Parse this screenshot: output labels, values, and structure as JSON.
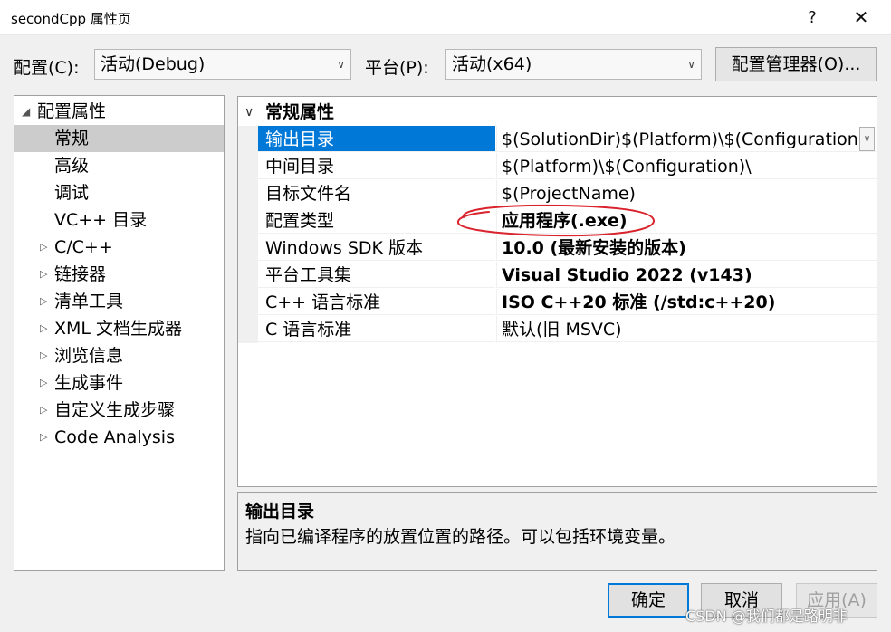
{
  "window": {
    "title": "secondCpp 属性页",
    "help_glyph": "?",
    "close_glyph": "✕"
  },
  "toolbar": {
    "config_label": "配置(C):",
    "config_value": "活动(Debug)",
    "platform_label": "平台(P):",
    "platform_value": "活动(x64)",
    "config_manager_label": "配置管理器(O)..."
  },
  "tree": {
    "items": [
      {
        "label": "配置属性",
        "expander": "open"
      },
      {
        "label": "常规",
        "expander": "none",
        "selected": true
      },
      {
        "label": "高级",
        "expander": "none"
      },
      {
        "label": "调试",
        "expander": "none"
      },
      {
        "label": "VC++ 目录",
        "expander": "none"
      },
      {
        "label": "C/C++",
        "expander": "closed"
      },
      {
        "label": "链接器",
        "expander": "closed"
      },
      {
        "label": "清单工具",
        "expander": "closed"
      },
      {
        "label": "XML 文档生成器",
        "expander": "closed"
      },
      {
        "label": "浏览信息",
        "expander": "closed"
      },
      {
        "label": "生成事件",
        "expander": "closed"
      },
      {
        "label": "自定义生成步骤",
        "expander": "closed"
      },
      {
        "label": "Code Analysis",
        "expander": "closed"
      }
    ]
  },
  "grid": {
    "category": "常规属性",
    "rows": [
      {
        "name": "输出目录",
        "value": "$(SolutionDir)$(Platform)\\$(Configuration)\\",
        "bold": false,
        "selected": true
      },
      {
        "name": "中间目录",
        "value": "$(Platform)\\$(Configuration)\\",
        "bold": false
      },
      {
        "name": "目标文件名",
        "value": "$(ProjectName)",
        "bold": false
      },
      {
        "name": "配置类型",
        "value": "应用程序(.exe)",
        "bold": true
      },
      {
        "name": "Windows SDK 版本",
        "value": "10.0 (最新安装的版本)",
        "bold": true
      },
      {
        "name": "平台工具集",
        "value": "Visual Studio 2022 (v143)",
        "bold": true
      },
      {
        "name": "C++ 语言标准",
        "value": "ISO C++20 标准 (/std:c++20)",
        "bold": true
      },
      {
        "name": "C 语言标准",
        "value": "默认(旧 MSVC)",
        "bold": false
      }
    ]
  },
  "description": {
    "title": "输出目录",
    "text": "指向已编译程序的放置位置的路径。可以包括环境变量。"
  },
  "buttons": {
    "ok": "确定",
    "cancel": "取消",
    "apply": "应用(A)"
  },
  "watermark": "CSDN @我们都是路明非",
  "colors": {
    "selection": "#0078d7",
    "tree_selected": "#cccccc",
    "annotation": "#d9232d"
  }
}
